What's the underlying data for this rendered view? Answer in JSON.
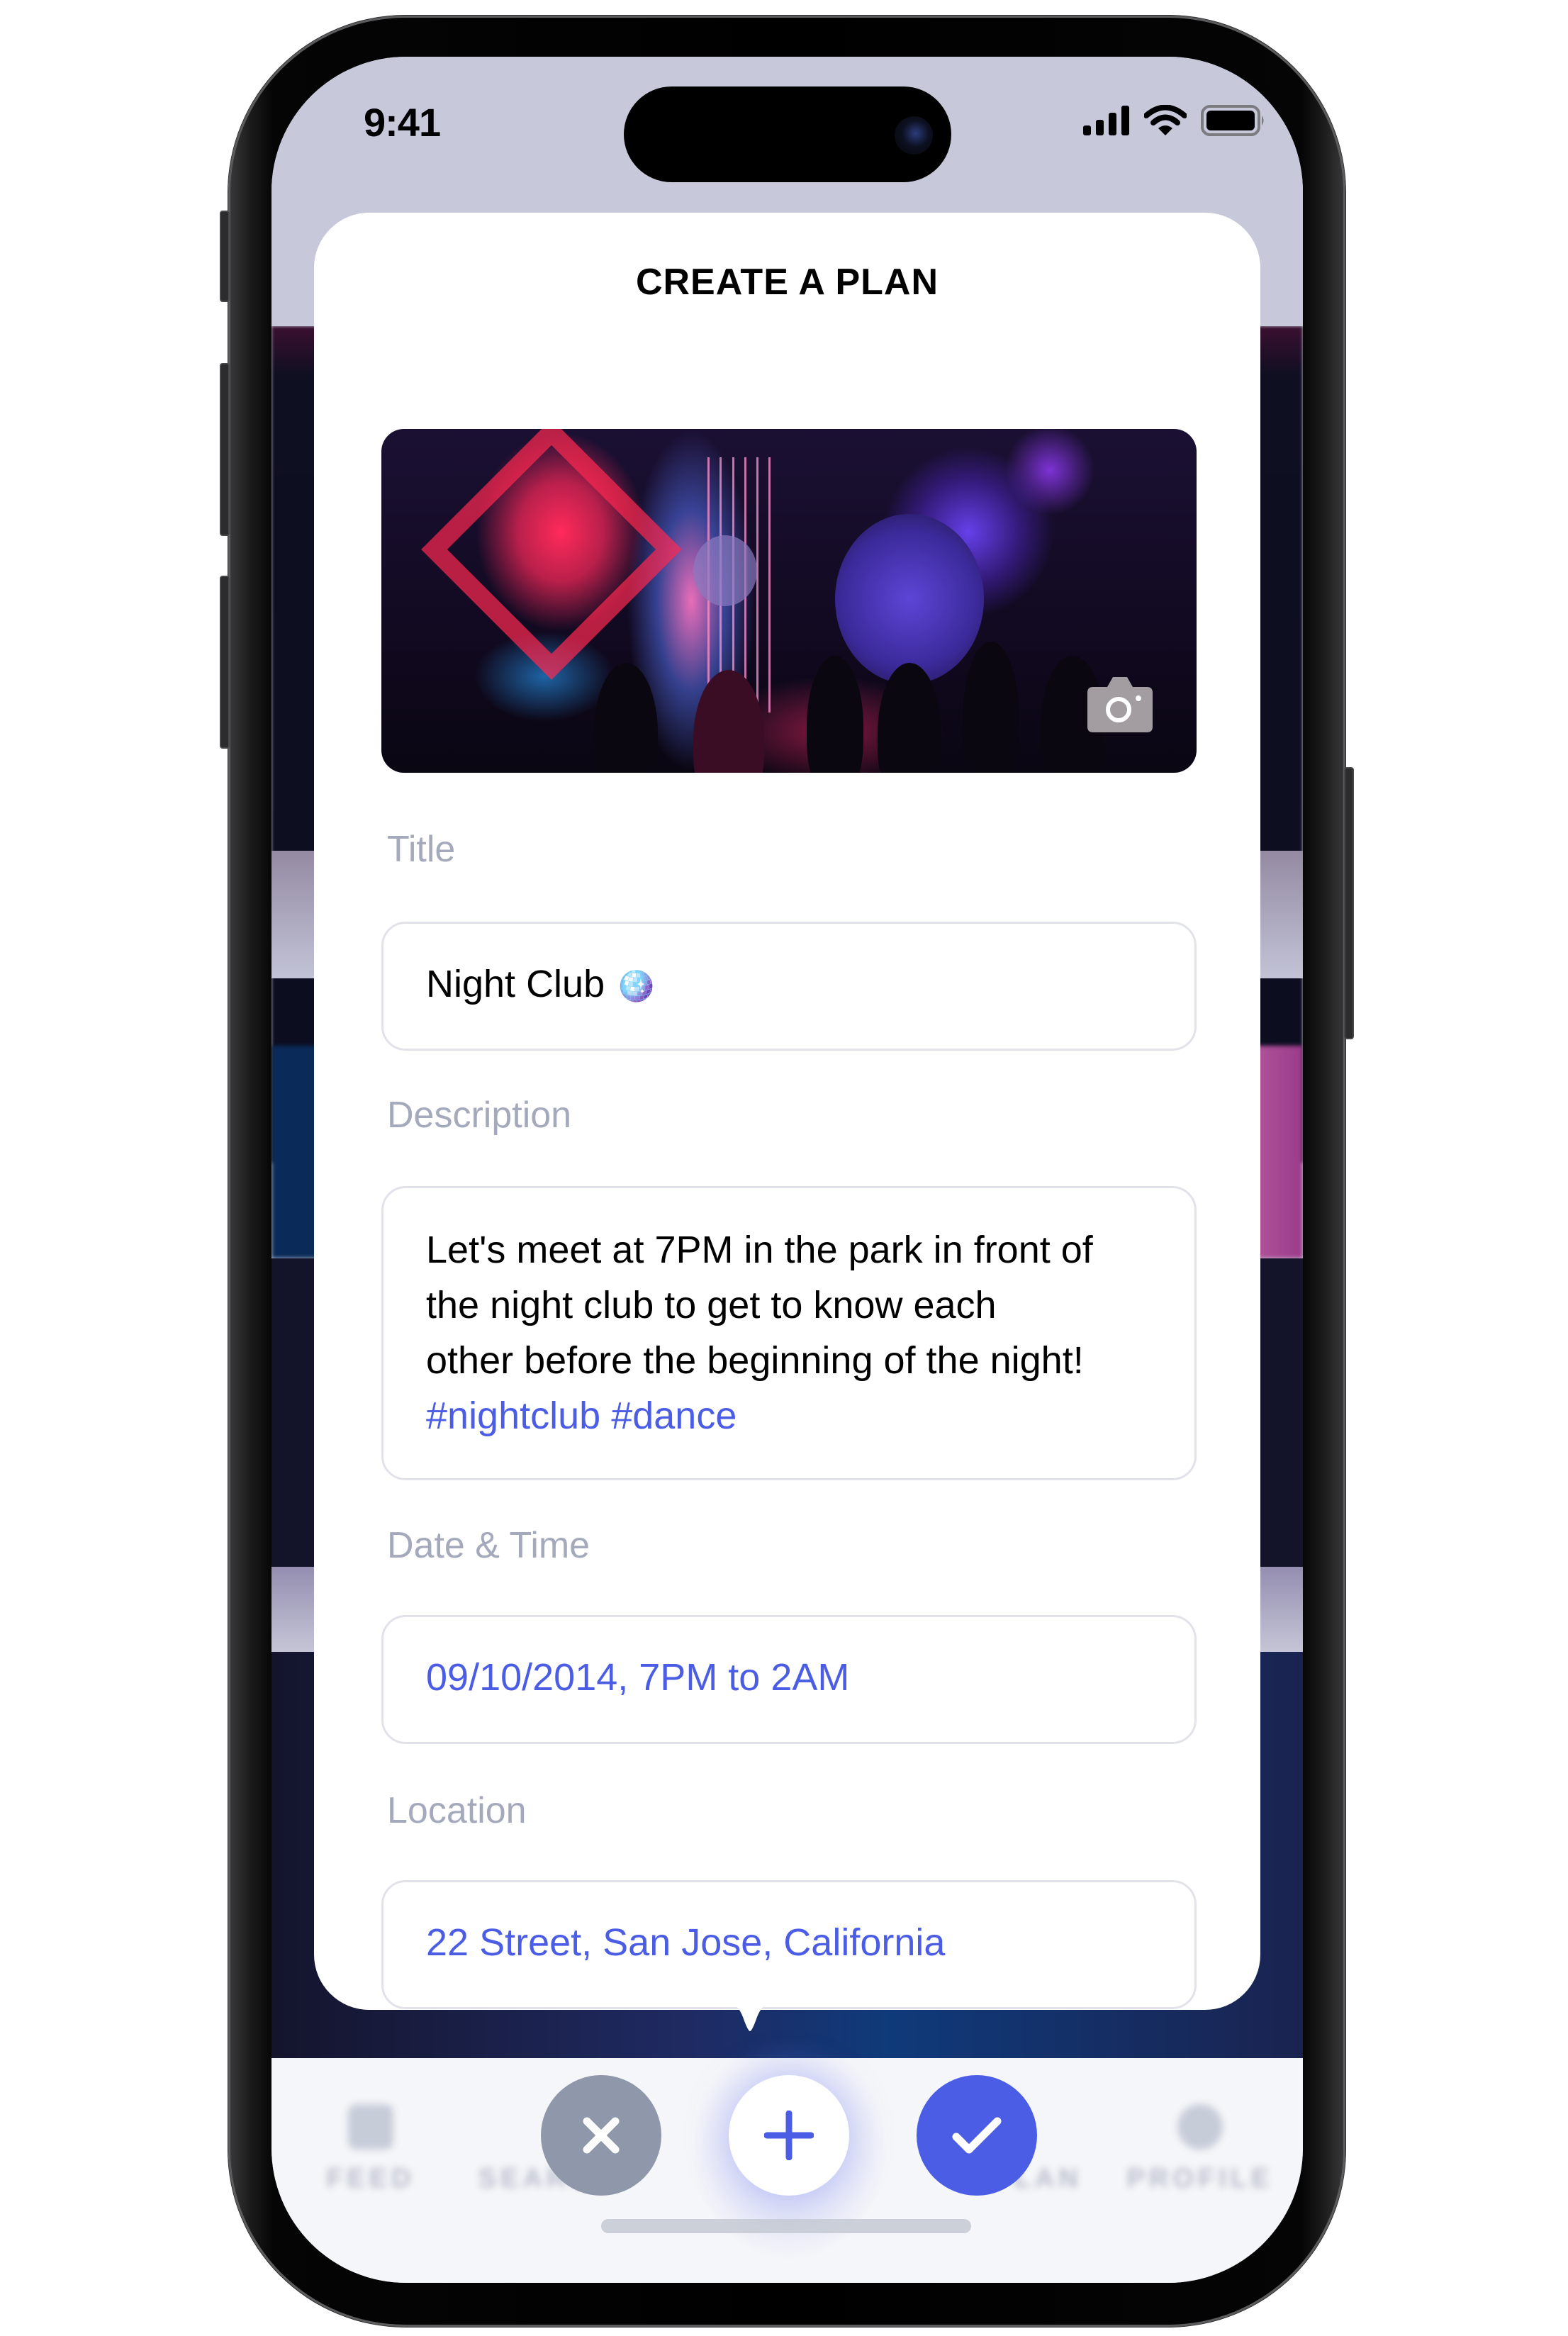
{
  "status_bar": {
    "time": "9:41",
    "icons": [
      "cellular-signal-icon",
      "wifi-icon",
      "battery-icon"
    ]
  },
  "card": {
    "title": "CREATE A PLAN",
    "cover_image": {
      "description": "Night club interior with neon lights and crowd",
      "change_photo_icon": "camera-icon"
    },
    "fields": {
      "title": {
        "label": "Title",
        "value": "Night Club",
        "emoji": "🪩"
      },
      "description": {
        "label": "Description",
        "lines": [
          "Let's meet at 7PM in the park in front of",
          "the night club to get to know each",
          "other before the beginning of the night!"
        ],
        "hashtags": "#nightclub #dance"
      },
      "date_time": {
        "label": "Date & Time",
        "value": "09/10/2014, 7PM to 2AM"
      },
      "location": {
        "label": "Location",
        "value": "22 Street, San Jose, California"
      }
    }
  },
  "tab_bar": {
    "tabs_behind": [
      {
        "label": "FEED",
        "icon": "feed-icon"
      },
      {
        "label": "SEARCH",
        "icon": "search-icon"
      },
      {
        "label": "PLAN",
        "icon": "plan-icon"
      },
      {
        "label": "PROFILE",
        "icon": "profile-icon"
      }
    ],
    "actions": {
      "cancel": {
        "icon": "close-icon",
        "color": "#8f97aa"
      },
      "add": {
        "icon": "plus-icon",
        "color": "#4b5de4"
      },
      "confirm": {
        "icon": "check-icon",
        "color": "#4b5de4"
      }
    }
  },
  "colors": {
    "accent": "#4b5de4",
    "label_gray": "#a4a9bb",
    "field_border": "#e2e3ea",
    "screen_bg": "#c7c8d9"
  }
}
